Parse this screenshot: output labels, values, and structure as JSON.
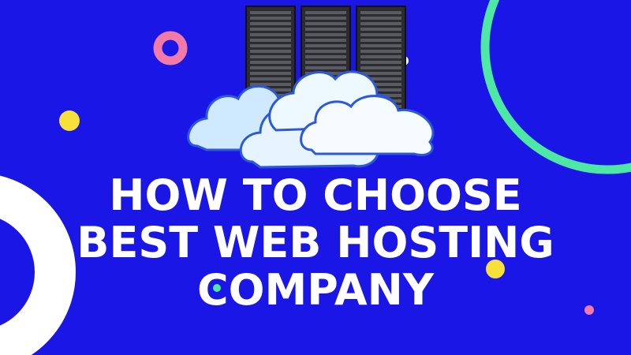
{
  "headline": {
    "line1": "HOW TO CHOOSE",
    "line2": "BEST WEB HOSTING",
    "line3": "COMPANY"
  },
  "colors": {
    "background": "#1a17e6",
    "text": "#ffffff",
    "pink_ring": "#f27aa8",
    "green_ring": "#4de8a3",
    "yellow_dot": "#f7e03a",
    "server_rack": "#2b2b30",
    "cloud_fill": "#e6f4ff",
    "cloud_stroke": "#1f3fb3"
  },
  "icons": [
    "server-rack-icon",
    "cloud-icon"
  ]
}
